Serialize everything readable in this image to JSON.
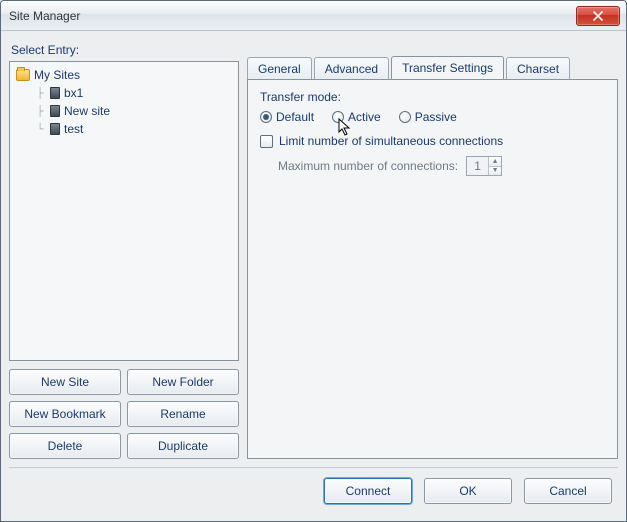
{
  "window": {
    "title": "Site Manager"
  },
  "left": {
    "select_label": "Select Entry:",
    "root_label": "My Sites",
    "sites": [
      {
        "label": "bx1"
      },
      {
        "label": "New site"
      },
      {
        "label": "test"
      }
    ],
    "buttons": {
      "new_site": "New Site",
      "new_folder": "New Folder",
      "new_bookmark": "New Bookmark",
      "rename": "Rename",
      "delete": "Delete",
      "duplicate": "Duplicate"
    }
  },
  "tabs": {
    "general": "General",
    "advanced": "Advanced",
    "transfer": "Transfer Settings",
    "charset": "Charset",
    "active": "transfer"
  },
  "transfer_panel": {
    "mode_label": "Transfer mode:",
    "radios": {
      "default": "Default",
      "active": "Active",
      "passive": "Passive",
      "selected": "default"
    },
    "limit_label": "Limit number of simultaneous connections",
    "limit_checked": false,
    "max_label": "Maximum number of connections:",
    "max_value": "1"
  },
  "actions": {
    "connect": "Connect",
    "ok": "OK",
    "cancel": "Cancel"
  }
}
